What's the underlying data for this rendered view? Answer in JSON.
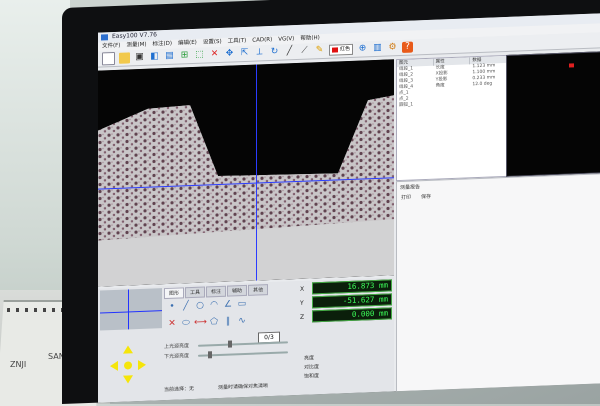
{
  "window": {
    "title": "Easy100 V7.76"
  },
  "menu": {
    "items": [
      "文件(F)",
      "测量(M)",
      "标注(D)",
      "编辑(E)",
      "设置(S)",
      "工具(T)",
      "CAD(R)",
      "VG(V)",
      "帮助(H)"
    ]
  },
  "toolbar": {
    "icons": [
      "new-file-icon",
      "open-folder-icon",
      "camera-icon",
      "camera-settings-icon",
      "image-tool-icon",
      "capture-icon",
      "select-icon",
      "delete-icon",
      "move-icon",
      "fit-icon",
      "rotate-icon",
      "refresh-icon",
      "line-icon",
      "measure-line-icon",
      "paint-icon",
      "color-select",
      "zoom-icon",
      "print-icon",
      "settings-icon",
      "help-icon"
    ],
    "color_label": "红色",
    "color_value": "#e01010"
  },
  "table": {
    "headers": [
      "图元",
      "属性",
      "数据"
    ],
    "rows": [
      {
        "item": "线段_1",
        "prop": "长度",
        "data": "1.123 mm"
      },
      {
        "item": "线段_2",
        "prop": "X投影",
        "data": "1.100 mm"
      },
      {
        "item": "线段_3",
        "prop": "Y投影",
        "data": "0.233 mm"
      },
      {
        "item": "线段_4",
        "prop": "角度",
        "data": "12.0 deg"
      },
      {
        "item": "点_1",
        "prop": "",
        "data": ""
      },
      {
        "item": "点_2",
        "prop": "",
        "data": ""
      },
      {
        "item": "圆弧_1",
        "prop": "",
        "data": ""
      }
    ]
  },
  "report": {
    "title": "测量报告",
    "options": [
      "打印",
      "保存"
    ]
  },
  "control": {
    "tabs": [
      "图形",
      "工具",
      "标注",
      "辅助",
      "其他"
    ],
    "readouts": [
      {
        "axis": "X",
        "value": "16.873 mm"
      },
      {
        "axis": "Y",
        "value": "-51.627 mm"
      },
      {
        "axis": "Z",
        "value": "0.000 mm"
      }
    ],
    "counter": "0/3",
    "slider_labels": [
      "上光源亮度",
      "下光源亮度"
    ],
    "right_labels": [
      "亮度",
      "对比度",
      "饱和度"
    ],
    "status_1": "当前选择：无",
    "status_2": "测量时请确保对焦清晰"
  },
  "notebook": {
    "text_1": "ZNJI",
    "text_2": "SANTA"
  }
}
